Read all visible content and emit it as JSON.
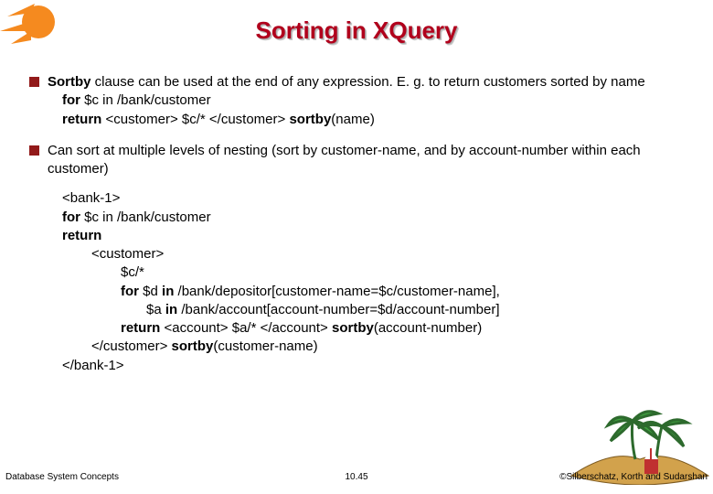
{
  "title": "Sorting in XQuery",
  "bullets": {
    "b1": {
      "lead_bold": "Sortby",
      "lead_rest": " clause can be used at the end of any expression.  E. g. to return customers sorted by name",
      "line2a": "for",
      "line2b": " $c in /bank/customer",
      "line3a": "return ",
      "line3b": "<customer> $c/* </customer> ",
      "line3c": "sortby",
      "line3d": "(name)"
    },
    "b2": {
      "text": "Can sort at multiple levels of nesting (sort  by customer-name, and by account-number within each customer)"
    }
  },
  "code": {
    "l1": "<bank-1>",
    "l2a": "for",
    "l2b": " $c in /bank/customer",
    "l3": "return",
    "l4": "<customer>",
    "l5": "$c/*",
    "l6a": "for",
    "l6b": " $d ",
    "l6c": "in",
    "l6d": " /bank/depositor[customer-name=$c/customer-name],",
    "l7a": "$a ",
    "l7b": "in",
    "l7c": " /bank/account[account-number=$d/account-number]",
    "l8a": "return",
    "l8b": " <account> $a/* </account> ",
    "l8c": "sortby",
    "l8d": "(account-number)",
    "l9a": "</customer> ",
    "l9b": "sortby",
    "l9c": "(customer-name)",
    "l10": "</bank-1>"
  },
  "footer": {
    "left": "Database System Concepts",
    "center": "10.45",
    "right": "©Silberschatz, Korth and Sudarshan"
  }
}
